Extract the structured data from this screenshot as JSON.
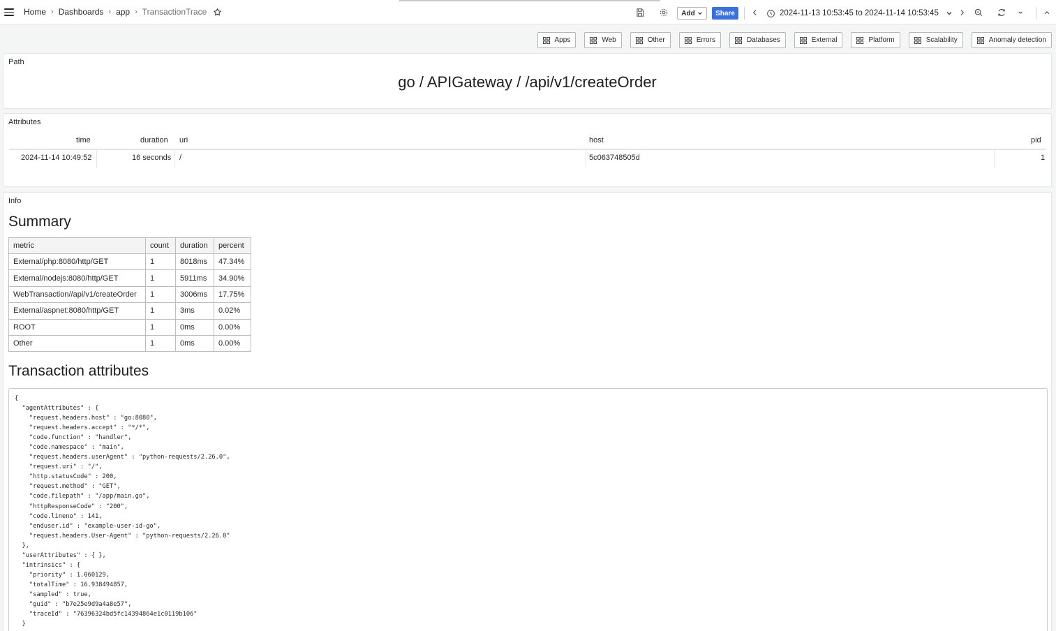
{
  "breadcrumb": {
    "items": [
      {
        "label": "Home",
        "name": "home"
      },
      {
        "label": "Dashboards",
        "name": "dashboards"
      },
      {
        "label": "app",
        "name": "app"
      },
      {
        "label": "TransactionTrace",
        "name": "transaction-trace"
      }
    ]
  },
  "toolbar": {
    "add_label": "Add",
    "share_label": "Share",
    "time_range": "2024-11-13 10:53:45 to 2024-11-14 10:53:45"
  },
  "link_buttons": [
    "Apps",
    "Web",
    "Other",
    "Errors",
    "Databases",
    "External",
    "Platform",
    "Scalability",
    "Anomaly detection"
  ],
  "path_panel": {
    "title": "Path",
    "value": "go / APIGateway / /api/v1/createOrder"
  },
  "attributes_panel": {
    "title": "Attributes",
    "columns": {
      "time": "time",
      "duration": "duration",
      "uri": "uri",
      "host": "host",
      "pid": "pid"
    },
    "row": {
      "time": "2024-11-14 10:49:52",
      "duration": "16 seconds",
      "uri": "/",
      "host": "5c063748505d",
      "pid": "1"
    }
  },
  "info_panel": {
    "title": "Info",
    "summary_heading": "Summary",
    "summary_columns": [
      "metric",
      "count",
      "duration",
      "percent"
    ],
    "summary_rows": [
      [
        "External/php:8080/http/GET",
        "1",
        "8018ms",
        "47.34%"
      ],
      [
        "External/nodejs:8080/http/GET",
        "1",
        "5911ms",
        "34.90%"
      ],
      [
        "WebTransaction//api/v1/createOrder",
        "1",
        "3006ms",
        "17.75%"
      ],
      [
        "External/aspnet:8080/http/GET",
        "1",
        "3ms",
        "0.02%"
      ],
      [
        "ROOT",
        "1",
        "0ms",
        "0.00%"
      ],
      [
        "Other",
        "1",
        "0ms",
        "0.00%"
      ]
    ],
    "transaction_heading": "Transaction attributes",
    "json_lines": [
      "{",
      "  \"agentAttributes\" : {",
      "    \"request.headers.host\" : \"go:8080\",",
      "    \"request.headers.accept\" : \"*/*\",",
      "    \"code.function\" : \"handler\",",
      "    \"code.namespace\" : \"main\",",
      "    \"request.headers.userAgent\" : \"python-requests/2.26.0\",",
      "    \"request.uri\" : \"/\",",
      "    \"http.statusCode\" : 200,",
      "    \"request.method\" : \"GET\",",
      "    \"code.filepath\" : \"/app/main.go\",",
      "    \"httpResponseCode\" : \"200\",",
      "    \"code.lineno\" : 141,",
      "    \"enduser.id\" : \"example-user-id-go\",",
      "    \"request.headers.User-Agent\" : \"python-requests/2.26.0\"",
      "  },",
      "  \"userAttributes\" : { },",
      "  \"intrinsics\" : {",
      "    \"priority\" : 1.060129,",
      "    \"totalTime\" : 16.938494857,",
      "    \"sampled\" : true,",
      "    \"guid\" : \"b7e25e9d9a4a8e57\",",
      "    \"traceId\" : \"76396324bd5fc14394864e1c0119b106\"",
      "  }"
    ]
  },
  "colors": {
    "share": "#3871dc",
    "background": "#f4f5f5"
  }
}
